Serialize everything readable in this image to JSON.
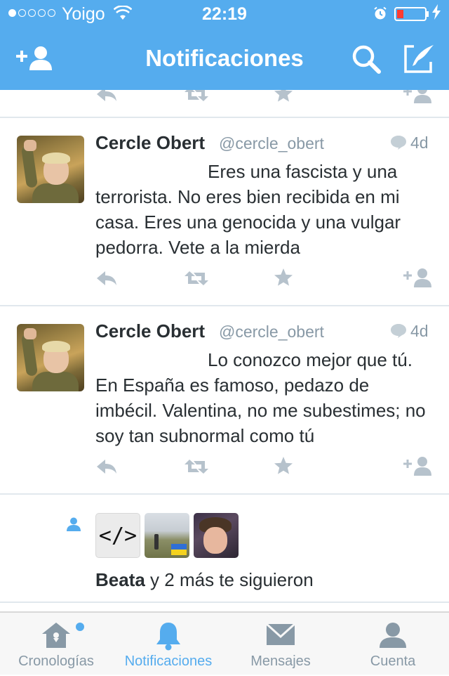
{
  "status_bar": {
    "carrier": "Yoigo",
    "time": "22:19"
  },
  "nav": {
    "title": "Notificaciones"
  },
  "tweets": [
    {
      "name": "Cercle Obert",
      "handle": "@cercle_obert",
      "age": "4d",
      "text": "Eres una fascista y una terrorista. No eres bien recibida en mi casa. Eres una genocida y una vulgar pedorra. Vete a la mierda"
    },
    {
      "name": "Cercle Obert",
      "handle": "@cercle_obert",
      "age": "4d",
      "text": "Lo conozco mejor que tú. En España es famoso, pedazo de imbécil. Valentina, no me subestimes; no soy tan subnormal como tú"
    }
  ],
  "follow": {
    "code_avatar_text": "</>",
    "name": "Beata",
    "rest": " y 2 más te siguieron"
  },
  "tabs": [
    {
      "label": "Cronologías",
      "icon": "home-icon",
      "active": false
    },
    {
      "label": "Notificaciones",
      "icon": "bell-icon",
      "active": true
    },
    {
      "label": "Mensajes",
      "icon": "envelope-icon",
      "active": false
    },
    {
      "label": "Cuenta",
      "icon": "person-icon",
      "active": false
    }
  ],
  "colors": {
    "brand": "#55acee",
    "text": "#292f33",
    "muted": "#8899a6",
    "action_icon": "#b6c2cc",
    "separator": "#e1e8ed"
  }
}
